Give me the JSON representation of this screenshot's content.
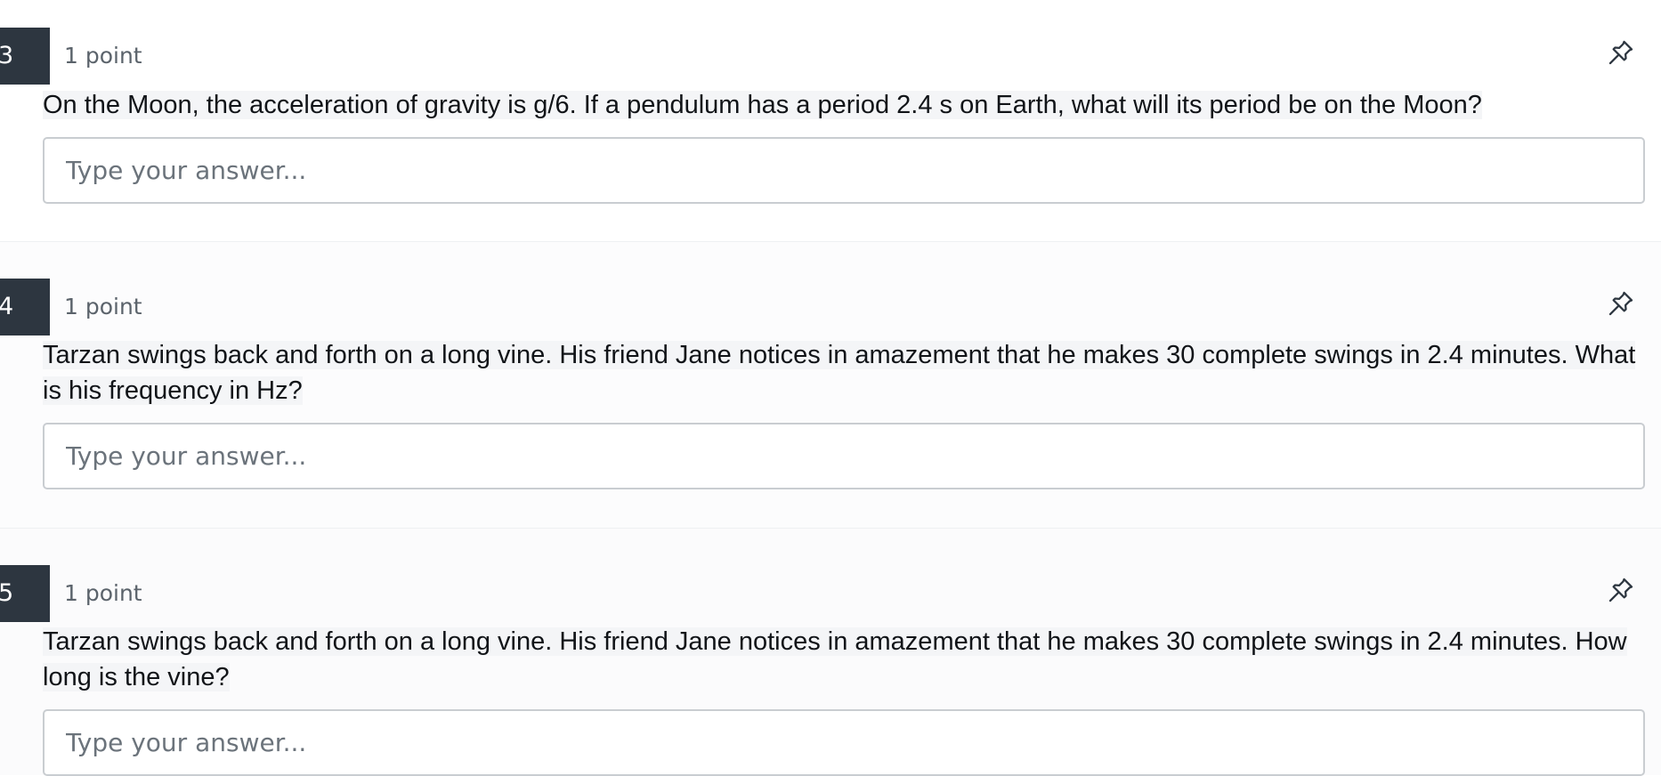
{
  "questions": [
    {
      "number": "3",
      "points": "1 point",
      "pin_icon": "pin-icon",
      "prompt": "On the Moon, the acceleration of gravity is g/6. If a pendulum has a period 2.4 s on Earth, what will its period be on the Moon?",
      "answer_placeholder": "Type your answer...",
      "answer_value": ""
    },
    {
      "number": "4",
      "points": "1 point",
      "pin_icon": "pin-icon",
      "prompt": "Tarzan swings back and forth on a long vine. His friend Jane notices in amazement that he makes 30 complete swings in 2.4 minutes. What is his frequency in Hz?",
      "answer_placeholder": "Type your answer...",
      "answer_value": ""
    },
    {
      "number": "5",
      "points": "1 point",
      "pin_icon": "pin-icon",
      "prompt": "Tarzan swings back and forth on a long vine. His friend Jane notices in amazement that he makes 30 complete swings in 2.4 minutes. How long is the vine?",
      "answer_placeholder": "Type your answer...",
      "answer_value": ""
    }
  ],
  "colors": {
    "number_badge_bg": "#2d3640",
    "number_badge_text": "#ffffff",
    "points_text": "#5b636b",
    "input_border": "#c9cdd1",
    "placeholder_text": "#6b737b"
  }
}
